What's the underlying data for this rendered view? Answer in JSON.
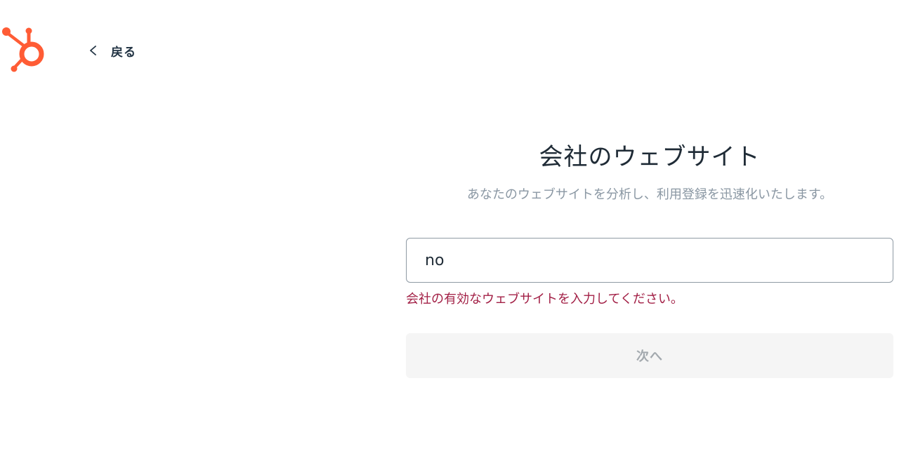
{
  "brand": {
    "accent_color": "#ff5c35",
    "logo_icon": "hubspot-sprocket-icon"
  },
  "nav": {
    "back_label": "戻る",
    "back_icon": "chevron-left-icon"
  },
  "step": {
    "title": "会社のウェブサイト",
    "subtitle": "あなたのウェブサイトを分析し、利用登録を迅速化いたします。",
    "website_input": {
      "value": "no",
      "placeholder": ""
    },
    "error_message": "会社の有効なウェブサイトを入力してください。",
    "error_color": "#a21f45",
    "next_label": "次へ",
    "next_disabled": true
  }
}
